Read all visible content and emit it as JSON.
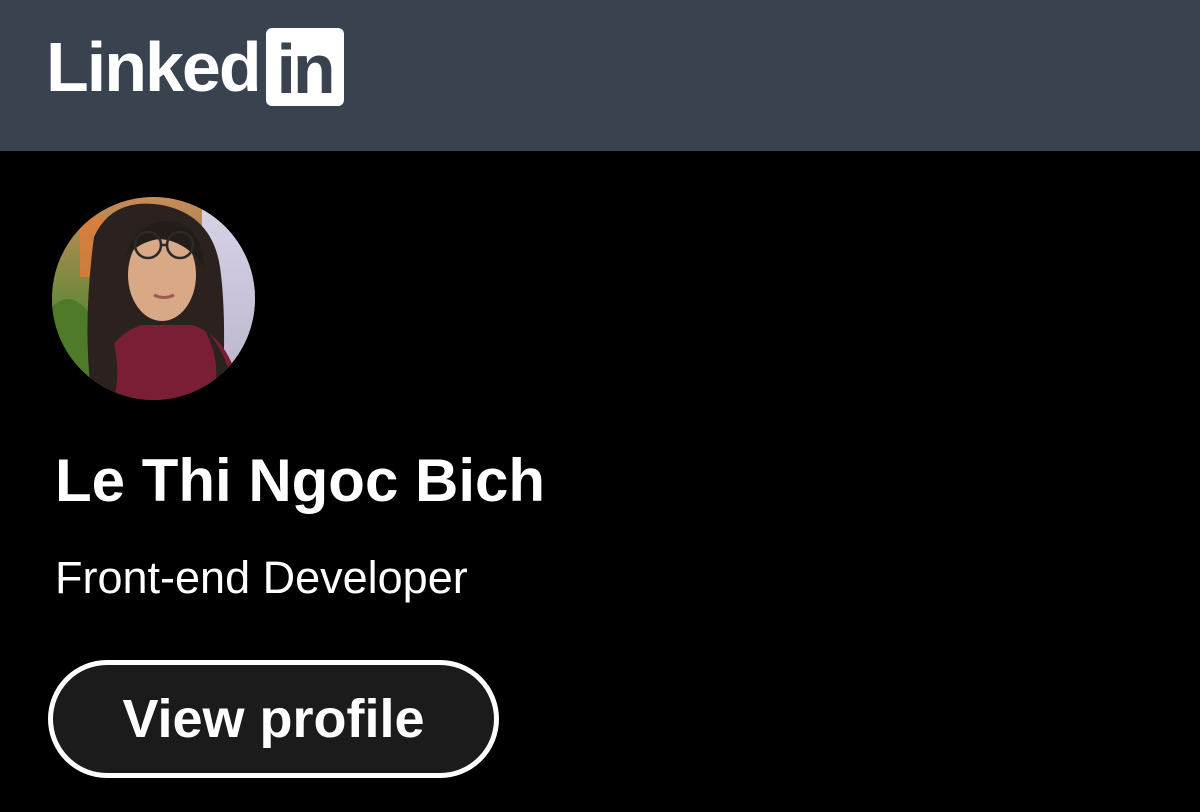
{
  "brand": {
    "word": "Linked",
    "box": "in",
    "header_color": "#38434f"
  },
  "profile": {
    "avatar_alt": "profile-photo",
    "name": "Le Thi Ngoc Bich",
    "headline": "Front-end Developer"
  },
  "actions": {
    "view_profile_label": "View profile"
  },
  "colors": {
    "background": "#000000",
    "text": "#ffffff",
    "button_bg": "#1b1b1b"
  }
}
